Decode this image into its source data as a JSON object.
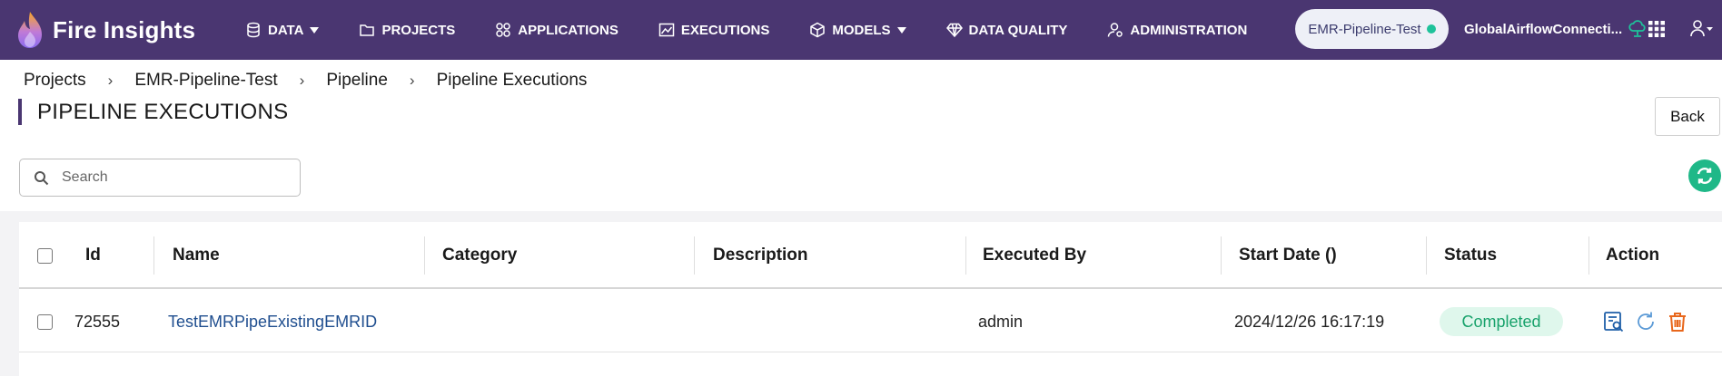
{
  "brand": {
    "name": "Fire Insights"
  },
  "nav": {
    "items": [
      {
        "label": "DATA",
        "icon": "database-icon",
        "dropdown": true
      },
      {
        "label": "PROJECTS",
        "icon": "folder-icon",
        "dropdown": false
      },
      {
        "label": "APPLICATIONS",
        "icon": "apps-grid-icon",
        "dropdown": false
      },
      {
        "label": "EXECUTIONS",
        "icon": "chart-window-icon",
        "dropdown": false
      },
      {
        "label": "MODELS",
        "icon": "cube-icon",
        "dropdown": true
      },
      {
        "label": "DATA QUALITY",
        "icon": "diamond-icon",
        "dropdown": false
      },
      {
        "label": "ADMINISTRATION",
        "icon": "user-gear-icon",
        "dropdown": false
      }
    ],
    "environment": "EMR-Pipeline-Test",
    "connection": "GlobalAirflowConnecti..."
  },
  "breadcrumb": [
    "Projects",
    "EMR-Pipeline-Test",
    "Pipeline",
    "Pipeline Executions"
  ],
  "breadcrumb_sep": "›",
  "page": {
    "title": "PIPELINE EXECUTIONS",
    "back_label": "Back",
    "search_placeholder": "Search"
  },
  "table": {
    "columns": [
      "Id",
      "Name",
      "Category",
      "Description",
      "Executed By",
      "Start Date ()",
      "Status",
      "Action"
    ],
    "rows": [
      {
        "id": "72555",
        "name": "TestEMRPipeExistingEMRID",
        "category": "",
        "description": "",
        "executed_by": "admin",
        "start_date": "2024/12/26 16:17:19",
        "status": "Completed"
      }
    ]
  },
  "colors": {
    "nav_bg": "#4a3671",
    "status_completed_bg": "#dff7ec",
    "status_completed_text": "#18a26b",
    "link": "#1f4e8f",
    "refresh": "#1fb888",
    "delete": "#e8671c"
  }
}
